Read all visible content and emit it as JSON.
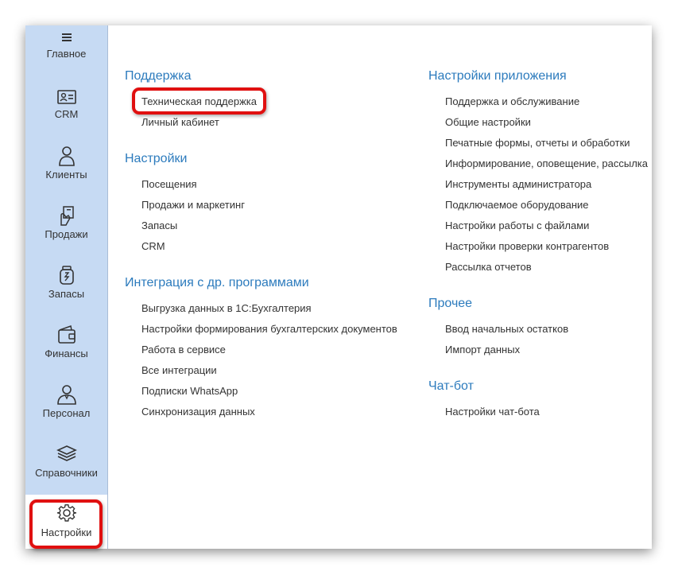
{
  "sidebar": {
    "items": [
      {
        "label": "Главное",
        "icon": "hamburger-icon"
      },
      {
        "label": "CRM",
        "icon": "contact-card-icon"
      },
      {
        "label": "Клиенты",
        "icon": "person-icon"
      },
      {
        "label": "Продажи",
        "icon": "hand-money-icon"
      },
      {
        "label": "Запасы",
        "icon": "jar-icon"
      },
      {
        "label": "Финансы",
        "icon": "wallet-icon"
      },
      {
        "label": "Персонал",
        "icon": "employee-icon"
      },
      {
        "label": "Справочники",
        "icon": "layers-icon"
      },
      {
        "label": "Настройки",
        "icon": "gear-icon"
      }
    ],
    "active": "Настройки"
  },
  "left_column": {
    "support": {
      "title": "Поддержка",
      "links": [
        "Техническая поддержка",
        "Личный кабинет"
      ]
    },
    "settings": {
      "title": "Настройки",
      "links": [
        "Посещения",
        "Продажи и маркетинг",
        "Запасы",
        "CRM"
      ]
    },
    "integration": {
      "title": "Интеграция с др. программами",
      "links": [
        "Выгрузка данных в 1С:Бухгалтерия",
        "Настройки формирования бухгалтерских документов",
        "Работа в сервисе",
        "Все интеграции",
        "Подписки WhatsApp",
        "Синхронизация данных"
      ]
    }
  },
  "right_column": {
    "app_settings": {
      "title": "Настройки приложения",
      "links": [
        "Поддержка и обслуживание",
        "Общие настройки",
        "Печатные формы, отчеты и обработки",
        "Информирование, оповещение, рассылка",
        "Инструменты администратора",
        "Подключаемое оборудование",
        "Настройки работы с файлами",
        "Настройки проверки контрагентов",
        "Рассылка отчетов"
      ]
    },
    "other": {
      "title": "Прочее",
      "links": [
        "Ввод начальных остатков",
        "Импорт данных"
      ]
    },
    "chatbot": {
      "title": "Чат-бот",
      "links": [
        "Настройки чат-бота"
      ]
    }
  },
  "colors": {
    "sidebar_bg": "#c6daf3",
    "section_title": "#2c7bbd",
    "highlight": "#e01010"
  }
}
